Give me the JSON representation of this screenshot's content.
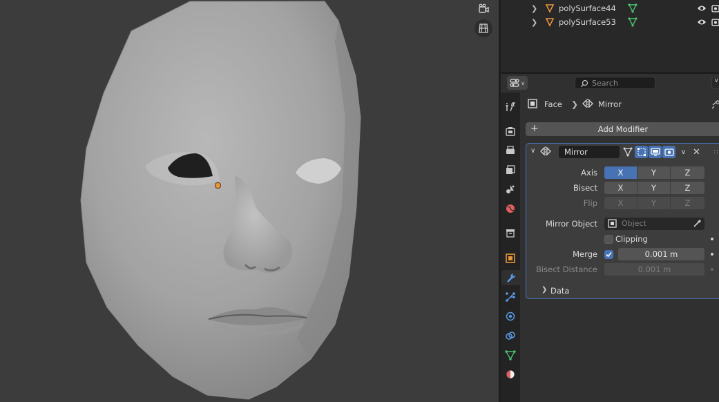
{
  "outliner": {
    "rows": [
      {
        "name": "polySurface44"
      },
      {
        "name": "polySurface53"
      }
    ]
  },
  "header": {
    "search_placeholder": "Search"
  },
  "breadcrumb": {
    "object": "Face",
    "modifier": "Mirror"
  },
  "add_modifier_label": "Add Modifier",
  "modifier": {
    "name": "Mirror",
    "axis": {
      "label": "Axis",
      "x": "X",
      "y": "Y",
      "z": "Z",
      "selected": "X"
    },
    "bisect": {
      "label": "Bisect",
      "x": "X",
      "y": "Y",
      "z": "Z"
    },
    "flip": {
      "label": "Flip",
      "x": "X",
      "y": "Y",
      "z": "Z"
    },
    "mirror_object": {
      "label": "Mirror Object",
      "placeholder": "Object"
    },
    "clipping": {
      "label": "Clipping",
      "checked": false
    },
    "merge": {
      "label": "Merge",
      "checked": true,
      "value": "0.001 m"
    },
    "bisect_distance": {
      "label": "Bisect Distance",
      "value": "0.001 m"
    },
    "data_section": "Data"
  },
  "colors": {
    "accent": "#4772b3",
    "object_orange": "#e8953a",
    "mesh_green": "#48c26e"
  },
  "icons": {
    "viewport": [
      "camera-view-icon",
      "grid-view-icon"
    ],
    "tabs": [
      "tool-icon",
      "render-icon",
      "output-icon",
      "view-layer-icon",
      "scene-icon",
      "world-icon",
      "collection-icon",
      "object-icon",
      "modifier-icon",
      "particles-icon",
      "physics-icon",
      "constraints-icon",
      "data-icon",
      "material-icon"
    ]
  }
}
